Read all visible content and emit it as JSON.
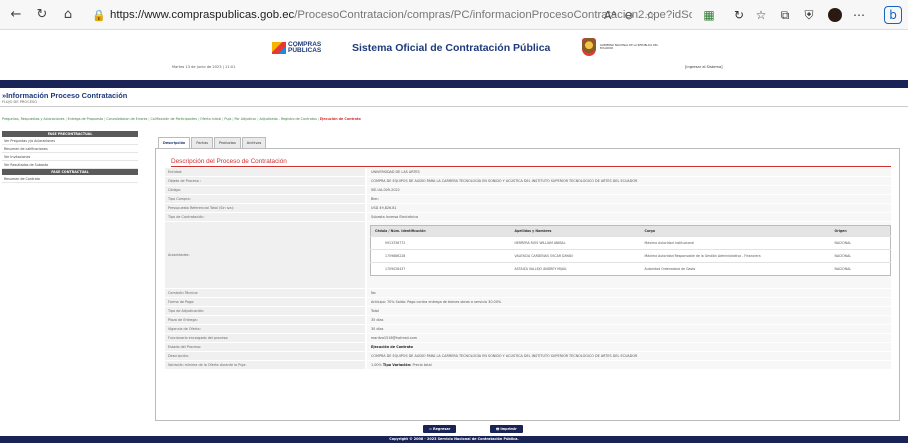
{
  "browser": {
    "url_host": "https://www.compraspublicas.gob.ec",
    "url_path": "/ProcesoContratacion/compras/PC/informacionProcesoContratacion2.cpe?idSoliCompra=YxZKDH...",
    "reader_label": "Aᴬ"
  },
  "header": {
    "logo_text": "COMPRAS PÚBLICAS",
    "site_title": "Sistema Oficial de Contratación Pública",
    "gov_text": "GOBIERNO NACIONAL DE LA REPÚBLICA DEL ECUADOR",
    "date": "Martes 13 de Junio de 2023 | 11:01",
    "login": "[Ingresar al Sistema]"
  },
  "page": {
    "title": "»Información Proceso Contratación",
    "subtitle": "FLUJO DE PROCESO"
  },
  "flow": [
    {
      "label": "Preguntas, Respuestas y Aclaraciones",
      "active": false
    },
    {
      "label": "Entrega de Propuesta",
      "active": false
    },
    {
      "label": "Convalidacion de Errores",
      "active": false
    },
    {
      "label": "Calificación de Participantes",
      "active": false
    },
    {
      "label": "Oferta Inicial",
      "active": false
    },
    {
      "label": "Puja",
      "active": false
    },
    {
      "label": "Por Adjudicar",
      "active": false
    },
    {
      "label": "Adjudicado - Registro de Contratos",
      "active": false
    },
    {
      "label": "Ejecución de Contrato",
      "active": true
    }
  ],
  "sidebar": {
    "pre_head": "FASE PRECONTRACTUAL",
    "pre_items": [
      "Ver Preguntas y/o Aclaraciones",
      "Resumen de calificaciones",
      "Ver Invitaciones",
      "Ver Resultados de Subasta"
    ],
    "con_head": "FASE CONTRACTUAL",
    "con_items": [
      "Resumen de Contrato"
    ]
  },
  "tabs": [
    "Descripción",
    "Fechas",
    "Productos",
    "Archivos"
  ],
  "section_title": "Descripción del Proceso de Contratación",
  "rows_top": [
    {
      "label": "Entidad:",
      "value": "UNIVERSIDAD DE LAS ARTES"
    },
    {
      "label": "Objeto de Proceso :",
      "value": "COMPRA DE EQUIPOS DE AUDIO PARA LA CARRERA TECNOLOGÍA EN SONIDO Y ACÚSTICA DEL INSTITUTO SUPERIOR TECNOLÓGICO DE ARTES DEL ECUADOR"
    },
    {
      "label": "Código:",
      "value": "SIE-UA-009-2022"
    },
    {
      "label": "Tipo Compra:",
      "value": "Bien"
    },
    {
      "label": "Presupuesto Referencial Total (Sin iva):",
      "value": "USD 49,826.81"
    },
    {
      "label": "Tipo de Contratación:",
      "value": "Subasta Inversa Electrónica"
    }
  ],
  "authorities": {
    "label": "Autoridades:",
    "headers": [
      "Cédula / Núm. Identificación",
      "Apellidos y Nombres",
      "Cargo",
      "Origen"
    ],
    "rows": [
      [
        "0913336772",
        "HERRERA RIOS WILLIAM ANIBAL",
        "Máxima Autoridad Institucional",
        "NACIONAL"
      ],
      [
        "1709886228",
        "VALENCIA CARDENAS OSCAR DAYAN",
        "Máxima Autoridad Responsable de la Gestión Administrativa - Financiera",
        "NACIONAL"
      ],
      [
        "1709028437",
        "ASTAIZA VALLEJO ANDREY MIJAIL",
        "Autoridad Ordenadora de Gasto",
        "NACIONAL"
      ]
    ]
  },
  "rows_bottom": [
    {
      "label": "Comisión Técnica:",
      "value": "No"
    },
    {
      "label": "Forma de Pago:",
      "value": "Anticipo: 70% Saldo: Pago contra entrega de bienes obras o servicio 30.00%"
    },
    {
      "label": "Tipo de Adjudicación:",
      "value": "Total"
    },
    {
      "label": "Plazo de Entrega:",
      "value": "35 días"
    },
    {
      "label": "Vigencia de Oferta:",
      "value": "30 días"
    },
    {
      "label": "Funcionario encargado del proceso:",
      "value": "maritza1516@hotmail.com"
    },
    {
      "label": "Estado del Proceso:",
      "value": "Ejecución de Contrato",
      "bold": true
    },
    {
      "label": "Descripción:",
      "value": "COMPRA DE EQUIPOS DE AUDIO PARA LA CARRERA TECNOLOGÍA EN SONIDO Y ACÚSTICA DEL INSTITUTO SUPERIOR TECNOLÓGICO DE ARTES DEL ECUADOR"
    }
  ],
  "puja_row": {
    "label": "Variación mínima de la Oferta durante la Puja:",
    "value": "1.00%",
    "tipo_label": "Tipo Variación:",
    "tipo_value": "Precio total"
  },
  "buttons": {
    "back": "⇦ Regresar",
    "print": "🖶 Imprimir"
  },
  "footer": "Copyright © 2008 - 2023 Servicio Nacional de Contratación Pública."
}
